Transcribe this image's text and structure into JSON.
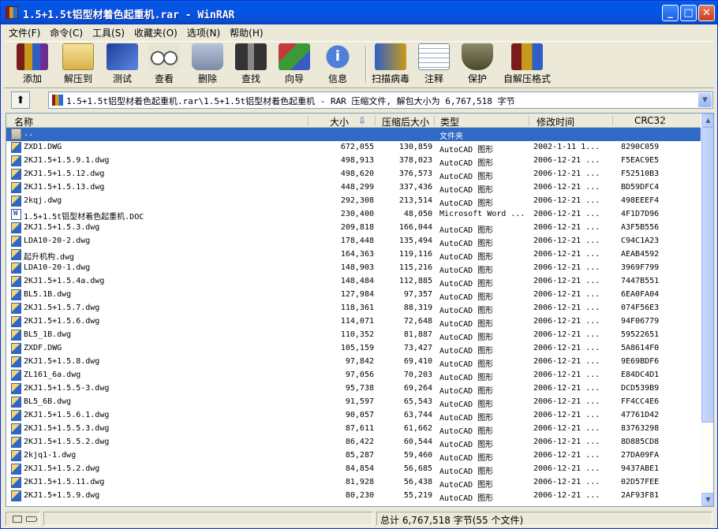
{
  "window": {
    "title": "1.5+1.5t铝型材着色起重机.rar - WinRAR"
  },
  "menu": [
    "文件(F)",
    "命令(C)",
    "工具(S)",
    "收藏夹(O)",
    "选项(N)",
    "帮助(H)"
  ],
  "toolbar": [
    {
      "label": "添加",
      "icon": "add-books-icon"
    },
    {
      "label": "解压到",
      "icon": "extract-folder-icon"
    },
    {
      "label": "测试",
      "icon": "test-book-icon"
    },
    {
      "label": "查看",
      "icon": "view-glasses-icon"
    },
    {
      "label": "删除",
      "icon": "delete-bin-icon"
    },
    {
      "label": "查找",
      "icon": "find-binoculars-icon"
    },
    {
      "label": "向导",
      "icon": "wizard-icon"
    },
    {
      "label": "信息",
      "icon": "info-icon"
    },
    {
      "label": "扫描病毒",
      "icon": "virus-scan-icon"
    },
    {
      "label": "注释",
      "icon": "comment-icon"
    },
    {
      "label": "保护",
      "icon": "protect-shield-icon"
    },
    {
      "label": "自解压格式",
      "icon": "sfx-icon"
    }
  ],
  "address": {
    "path": "1.5+1.5t铝型材着色起重机.rar\\1.5+1.5t铝型材着色起重机 - RAR 压缩文件, 解包大小为 6,767,518 字节"
  },
  "columns": {
    "name": "名称",
    "size": "大小",
    "packed": "压缩后大小",
    "type": "类型",
    "modified": "修改时间",
    "crc": "CRC32"
  },
  "sort_indicator": "⇩",
  "files": [
    {
      "name": "..",
      "size": "",
      "packed": "",
      "type": "文件夹",
      "modified": "",
      "crc": "",
      "icon": "folder",
      "selected": true
    },
    {
      "name": "ZXD1.DWG",
      "size": "672,055",
      "packed": "130,859",
      "type": "AutoCAD 图形",
      "modified": "2002-1-11 1...",
      "crc": "8290C059",
      "icon": "dwg"
    },
    {
      "name": "2KJ1.5+1.5.9.1.dwg",
      "size": "498,913",
      "packed": "378,023",
      "type": "AutoCAD 图形",
      "modified": "2006-12-21 ...",
      "crc": "F5EAC9E5",
      "icon": "dwg"
    },
    {
      "name": "2KJ1.5+1.5.12.dwg",
      "size": "498,620",
      "packed": "376,573",
      "type": "AutoCAD 图形",
      "modified": "2006-12-21 ...",
      "crc": "F52510B3",
      "icon": "dwg"
    },
    {
      "name": "2KJ1.5+1.5.13.dwg",
      "size": "448,299",
      "packed": "337,436",
      "type": "AutoCAD 图形",
      "modified": "2006-12-21 ...",
      "crc": "BD59DFC4",
      "icon": "dwg"
    },
    {
      "name": "2kqj.dwg",
      "size": "292,308",
      "packed": "213,514",
      "type": "AutoCAD 图形",
      "modified": "2006-12-21 ...",
      "crc": "498EEEF4",
      "icon": "dwg"
    },
    {
      "name": "1.5+1.5t铝型材着色起重机.DOC",
      "size": "230,400",
      "packed": "48,050",
      "type": "Microsoft Word ...",
      "modified": "2006-12-21 ...",
      "crc": "4F1D7D96",
      "icon": "doc"
    },
    {
      "name": "2KJ1.5+1.5.3.dwg",
      "size": "209,818",
      "packed": "166,044",
      "type": "AutoCAD 图形",
      "modified": "2006-12-21 ...",
      "crc": "A3F5B556",
      "icon": "dwg"
    },
    {
      "name": "LDA10-20-2.dwg",
      "size": "178,448",
      "packed": "135,494",
      "type": "AutoCAD 图形",
      "modified": "2006-12-21 ...",
      "crc": "C94C1A23",
      "icon": "dwg"
    },
    {
      "name": "起升机构.dwg",
      "size": "164,363",
      "packed": "119,116",
      "type": "AutoCAD 图形",
      "modified": "2006-12-21 ...",
      "crc": "AEAB4592",
      "icon": "dwg"
    },
    {
      "name": "LDA10-20-1.dwg",
      "size": "148,903",
      "packed": "115,216",
      "type": "AutoCAD 图形",
      "modified": "2006-12-21 ...",
      "crc": "3969F799",
      "icon": "dwg"
    },
    {
      "name": "2KJ1.5+1.5.4a.dwg",
      "size": "148,484",
      "packed": "112,885",
      "type": "AutoCAD 图形",
      "modified": "2006-12-21 ...",
      "crc": "7447B551",
      "icon": "dwg"
    },
    {
      "name": "BL5.1B.dwg",
      "size": "127,984",
      "packed": "97,357",
      "type": "AutoCAD 图形",
      "modified": "2006-12-21 ...",
      "crc": "6EA0FA04",
      "icon": "dwg"
    },
    {
      "name": "2KJ1.5+1.5.7.dwg",
      "size": "118,361",
      "packed": "88,319",
      "type": "AutoCAD 图形",
      "modified": "2006-12-21 ...",
      "crc": "074F56E3",
      "icon": "dwg"
    },
    {
      "name": "2KJ1.5+1.5.6.dwg",
      "size": "114,071",
      "packed": "72,648",
      "type": "AutoCAD 图形",
      "modified": "2006-12-21 ...",
      "crc": "94F06779",
      "icon": "dwg"
    },
    {
      "name": "BL5_1B.dwg",
      "size": "110,352",
      "packed": "81,887",
      "type": "AutoCAD 图形",
      "modified": "2006-12-21 ...",
      "crc": "59522651",
      "icon": "dwg"
    },
    {
      "name": "ZXDF.DWG",
      "size": "105,159",
      "packed": "73,427",
      "type": "AutoCAD 图形",
      "modified": "2006-12-21 ...",
      "crc": "5A8614F0",
      "icon": "dwg"
    },
    {
      "name": "2KJ1.5+1.5.8.dwg",
      "size": "97,842",
      "packed": "69,410",
      "type": "AutoCAD 图形",
      "modified": "2006-12-21 ...",
      "crc": "9E69BDF6",
      "icon": "dwg"
    },
    {
      "name": "ZL161_6a.dwg",
      "size": "97,056",
      "packed": "70,203",
      "type": "AutoCAD 图形",
      "modified": "2006-12-21 ...",
      "crc": "E84DC4D1",
      "icon": "dwg"
    },
    {
      "name": "2KJ1.5+1.5.5-3.dwg",
      "size": "95,738",
      "packed": "69,264",
      "type": "AutoCAD 图形",
      "modified": "2006-12-21 ...",
      "crc": "DCD539B9",
      "icon": "dwg"
    },
    {
      "name": "BL5_6B.dwg",
      "size": "91,597",
      "packed": "65,543",
      "type": "AutoCAD 图形",
      "modified": "2006-12-21 ...",
      "crc": "FF4CC4E6",
      "icon": "dwg"
    },
    {
      "name": "2KJ1.5+1.5.6.1.dwg",
      "size": "90,057",
      "packed": "63,744",
      "type": "AutoCAD 图形",
      "modified": "2006-12-21 ...",
      "crc": "47761D42",
      "icon": "dwg"
    },
    {
      "name": "2KJ1.5+1.5.5.3.dwg",
      "size": "87,611",
      "packed": "61,662",
      "type": "AutoCAD 图形",
      "modified": "2006-12-21 ...",
      "crc": "83763298",
      "icon": "dwg"
    },
    {
      "name": "2KJ1.5+1.5.5.2.dwg",
      "size": "86,422",
      "packed": "60,544",
      "type": "AutoCAD 图形",
      "modified": "2006-12-21 ...",
      "crc": "8D885CD8",
      "icon": "dwg"
    },
    {
      "name": "2kjq1-1.dwg",
      "size": "85,287",
      "packed": "59,460",
      "type": "AutoCAD 图形",
      "modified": "2006-12-21 ...",
      "crc": "27DA09FA",
      "icon": "dwg"
    },
    {
      "name": "2KJ1.5+1.5.2.dwg",
      "size": "84,854",
      "packed": "56,685",
      "type": "AutoCAD 图形",
      "modified": "2006-12-21 ...",
      "crc": "9437ABE1",
      "icon": "dwg"
    },
    {
      "name": "2KJ1.5+1.5.11.dwg",
      "size": "81,928",
      "packed": "56,438",
      "type": "AutoCAD 图形",
      "modified": "2006-12-21 ...",
      "crc": "02D57FEE",
      "icon": "dwg"
    },
    {
      "name": "2KJ1.5+1.5.9.dwg",
      "size": "80,230",
      "packed": "55,219",
      "type": "AutoCAD 图形",
      "modified": "2006-12-21 ...",
      "crc": "2AF93F81",
      "icon": "dwg"
    }
  ],
  "status": {
    "summary": "总计 6,767,518 字节(55 个文件)"
  },
  "colors": {
    "titlebar": "#0454e8",
    "selection": "#316ac5",
    "chrome": "#ece9d8"
  }
}
